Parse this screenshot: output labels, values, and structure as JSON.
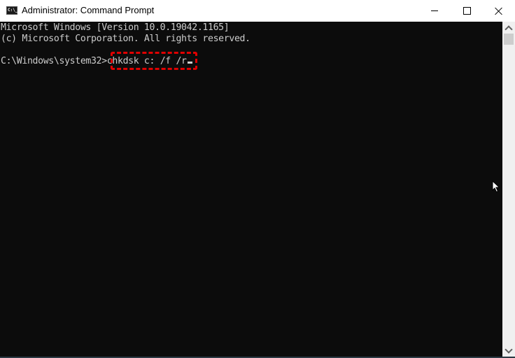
{
  "window": {
    "title": "Administrator: Command Prompt",
    "icon": "cmd-icon",
    "icon_text": "C:\\_",
    "controls": {
      "minimize": "minimize-icon",
      "maximize": "maximize-icon",
      "close": "close-icon"
    }
  },
  "console": {
    "lines": [
      "Microsoft Windows [Version 10.0.19042.1165]",
      "(c) Microsoft Corporation. All rights reserved."
    ],
    "prompt": "C:\\Windows\\system32>",
    "command": "chkdsk c: /f /r",
    "highlight_color": "#e00000",
    "text_color": "#cccccc",
    "background_color": "#0c0c0c"
  },
  "scrollbar": {
    "up_icon": "chevron-up-icon",
    "down_icon": "chevron-down-icon"
  }
}
